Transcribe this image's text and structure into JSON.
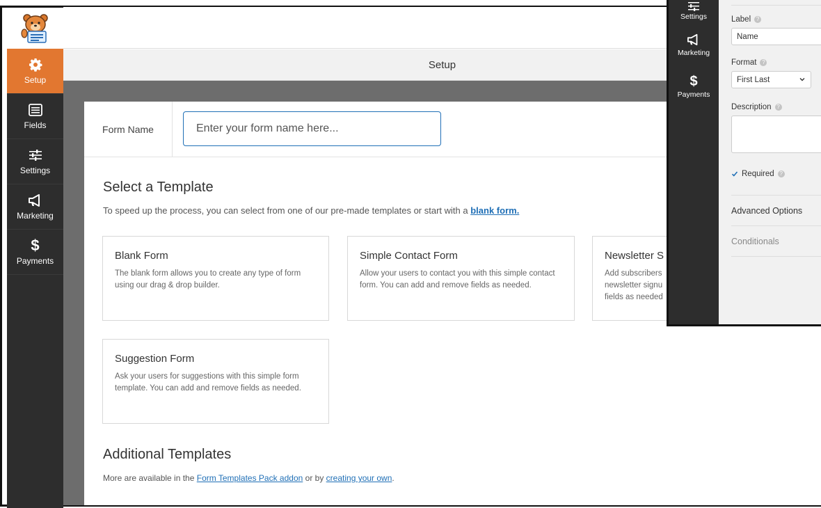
{
  "header": {
    "setup_title": "Setup"
  },
  "sidebar": {
    "items": [
      {
        "label": "Setup",
        "icon": "gear-icon",
        "active": true
      },
      {
        "label": "Fields",
        "icon": "list-icon"
      },
      {
        "label": "Settings",
        "icon": "sliders-icon"
      },
      {
        "label": "Marketing",
        "icon": "megaphone-icon"
      },
      {
        "label": "Payments",
        "icon": "dollar-icon"
      }
    ]
  },
  "form_name": {
    "label": "Form Name",
    "placeholder": "Enter your form name here..."
  },
  "select_template": {
    "title": "Select a Template",
    "desc_prefix": "To speed up the process, you can select from one of our pre-made templates or start with a",
    "desc_link": "blank form."
  },
  "templates": [
    {
      "title": "Blank Form",
      "desc": "The blank form allows you to create any type of form using our drag & drop builder."
    },
    {
      "title": "Simple Contact Form",
      "desc": "Allow your users to contact you with this simple contact form. You can add and remove fields as needed."
    },
    {
      "title": "Newsletter S",
      "desc_lines": [
        "Add subscribers",
        "newsletter signu",
        "fields as needed"
      ]
    },
    {
      "title": "Suggestion Form",
      "desc": "Ask your users for suggestions with this simple form template. You can add and remove fields as needed."
    }
  ],
  "additional": {
    "title": "Additional Templates",
    "desc_prefix": "More are available in the",
    "link1": "Form Templates Pack addon",
    "desc_mid": "or by",
    "link2": "creating your own",
    "desc_suffix": "."
  },
  "overlay": {
    "sidebar": [
      {
        "label": "Settings",
        "icon": "sliders-icon"
      },
      {
        "label": "Marketing",
        "icon": "megaphone-icon"
      },
      {
        "label": "Payments",
        "icon": "dollar-icon"
      }
    ],
    "label_label": "Label",
    "label_value": "Name",
    "format_label": "Format",
    "format_value": "First Last",
    "description_label": "Description",
    "required_label": "Required",
    "advanced_label": "Advanced Options",
    "conditionals_label": "Conditionals"
  },
  "colors": {
    "accent": "#e27730",
    "sidebar": "#2d2d2d",
    "link": "#1f6fb6"
  }
}
